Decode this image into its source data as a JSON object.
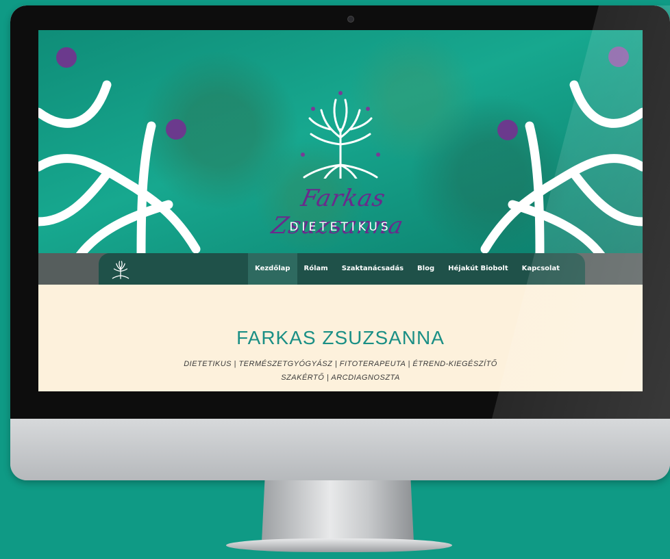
{
  "hero": {
    "script_name": "Farkas Zsuzsanna",
    "subtitle": "DIETETIKUS"
  },
  "nav": {
    "items": [
      {
        "label": "Kezdőlap",
        "active": true
      },
      {
        "label": "Rólam",
        "active": false
      },
      {
        "label": "Szaktanácsadás",
        "active": false
      },
      {
        "label": "Blog",
        "active": false
      },
      {
        "label": "Héjakút Biobolt",
        "active": false
      },
      {
        "label": "Kapcsolat",
        "active": false
      }
    ]
  },
  "content": {
    "title": "FARKAS ZSUZSANNA",
    "subtitle": "DIETETIKUS | TERMÉSZETGYÓGYÁSZ | FITOTERAPEUTA | ÉTREND-KIEGÉSZÍTŐ SZAKÉRTŐ | ARCDIAGNOSZTA"
  },
  "colors": {
    "background": "#0f9a85",
    "hero_teal": "#17a88f",
    "nav_dark": "#1f5149",
    "accent_purple": "#6a2a8c",
    "content_bg": "#fdf1dc",
    "title_teal": "#1b8f85"
  },
  "icons": {
    "logo": "tree-of-life-icon",
    "nav_logo": "tree-of-life-icon",
    "camera": "camera-icon"
  }
}
